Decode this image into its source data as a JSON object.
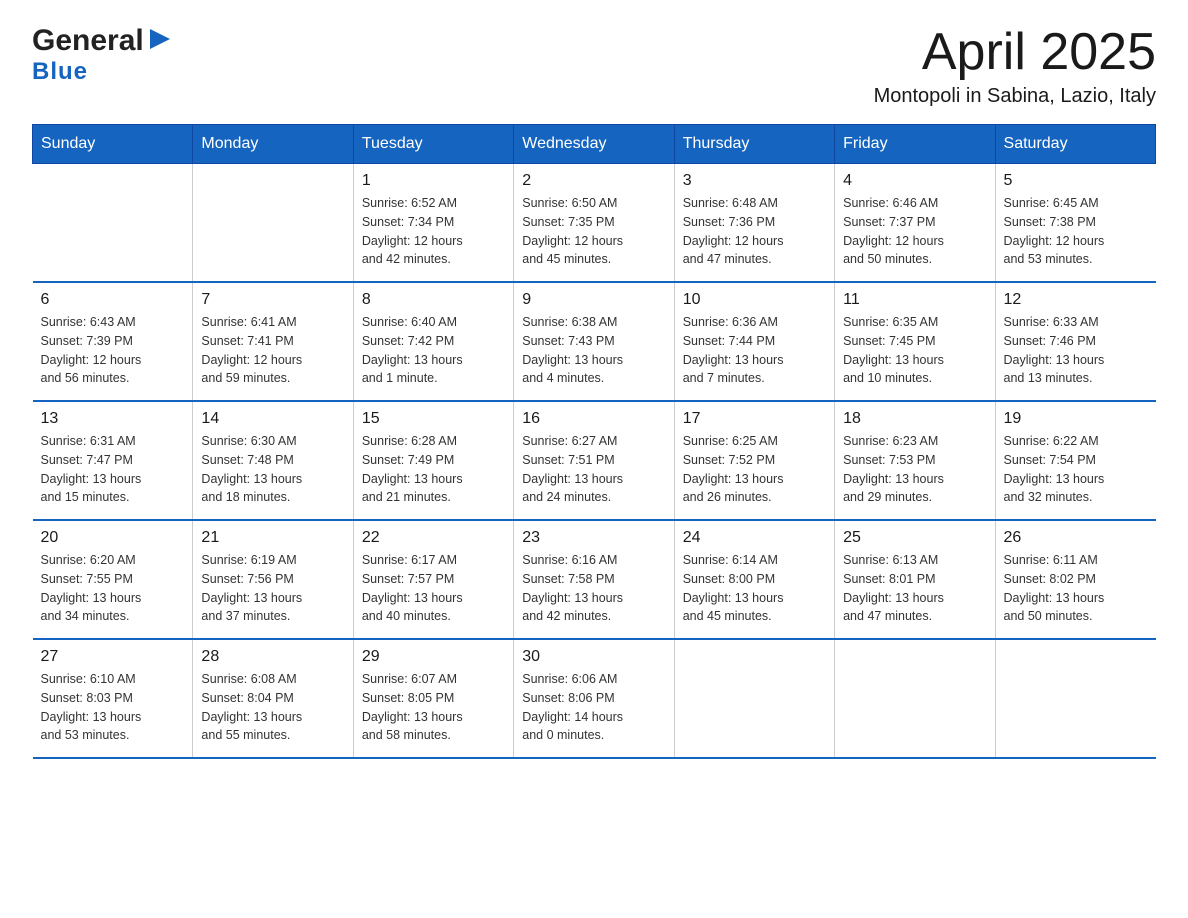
{
  "header": {
    "logo_general": "General",
    "logo_blue": "Blue",
    "title": "April 2025",
    "subtitle": "Montopoli in Sabina, Lazio, Italy"
  },
  "calendar": {
    "days_of_week": [
      "Sunday",
      "Monday",
      "Tuesday",
      "Wednesday",
      "Thursday",
      "Friday",
      "Saturday"
    ],
    "weeks": [
      [
        {
          "day": "",
          "sunrise": "",
          "sunset": "",
          "daylight": ""
        },
        {
          "day": "",
          "sunrise": "",
          "sunset": "",
          "daylight": ""
        },
        {
          "day": "1",
          "sunrise": "Sunrise: 6:52 AM",
          "sunset": "Sunset: 7:34 PM",
          "daylight": "Daylight: 12 hours and 42 minutes."
        },
        {
          "day": "2",
          "sunrise": "Sunrise: 6:50 AM",
          "sunset": "Sunset: 7:35 PM",
          "daylight": "Daylight: 12 hours and 45 minutes."
        },
        {
          "day": "3",
          "sunrise": "Sunrise: 6:48 AM",
          "sunset": "Sunset: 7:36 PM",
          "daylight": "Daylight: 12 hours and 47 minutes."
        },
        {
          "day": "4",
          "sunrise": "Sunrise: 6:46 AM",
          "sunset": "Sunset: 7:37 PM",
          "daylight": "Daylight: 12 hours and 50 minutes."
        },
        {
          "day": "5",
          "sunrise": "Sunrise: 6:45 AM",
          "sunset": "Sunset: 7:38 PM",
          "daylight": "Daylight: 12 hours and 53 minutes."
        }
      ],
      [
        {
          "day": "6",
          "sunrise": "Sunrise: 6:43 AM",
          "sunset": "Sunset: 7:39 PM",
          "daylight": "Daylight: 12 hours and 56 minutes."
        },
        {
          "day": "7",
          "sunrise": "Sunrise: 6:41 AM",
          "sunset": "Sunset: 7:41 PM",
          "daylight": "Daylight: 12 hours and 59 minutes."
        },
        {
          "day": "8",
          "sunrise": "Sunrise: 6:40 AM",
          "sunset": "Sunset: 7:42 PM",
          "daylight": "Daylight: 13 hours and 1 minute."
        },
        {
          "day": "9",
          "sunrise": "Sunrise: 6:38 AM",
          "sunset": "Sunset: 7:43 PM",
          "daylight": "Daylight: 13 hours and 4 minutes."
        },
        {
          "day": "10",
          "sunrise": "Sunrise: 6:36 AM",
          "sunset": "Sunset: 7:44 PM",
          "daylight": "Daylight: 13 hours and 7 minutes."
        },
        {
          "day": "11",
          "sunrise": "Sunrise: 6:35 AM",
          "sunset": "Sunset: 7:45 PM",
          "daylight": "Daylight: 13 hours and 10 minutes."
        },
        {
          "day": "12",
          "sunrise": "Sunrise: 6:33 AM",
          "sunset": "Sunset: 7:46 PM",
          "daylight": "Daylight: 13 hours and 13 minutes."
        }
      ],
      [
        {
          "day": "13",
          "sunrise": "Sunrise: 6:31 AM",
          "sunset": "Sunset: 7:47 PM",
          "daylight": "Daylight: 13 hours and 15 minutes."
        },
        {
          "day": "14",
          "sunrise": "Sunrise: 6:30 AM",
          "sunset": "Sunset: 7:48 PM",
          "daylight": "Daylight: 13 hours and 18 minutes."
        },
        {
          "day": "15",
          "sunrise": "Sunrise: 6:28 AM",
          "sunset": "Sunset: 7:49 PM",
          "daylight": "Daylight: 13 hours and 21 minutes."
        },
        {
          "day": "16",
          "sunrise": "Sunrise: 6:27 AM",
          "sunset": "Sunset: 7:51 PM",
          "daylight": "Daylight: 13 hours and 24 minutes."
        },
        {
          "day": "17",
          "sunrise": "Sunrise: 6:25 AM",
          "sunset": "Sunset: 7:52 PM",
          "daylight": "Daylight: 13 hours and 26 minutes."
        },
        {
          "day": "18",
          "sunrise": "Sunrise: 6:23 AM",
          "sunset": "Sunset: 7:53 PM",
          "daylight": "Daylight: 13 hours and 29 minutes."
        },
        {
          "day": "19",
          "sunrise": "Sunrise: 6:22 AM",
          "sunset": "Sunset: 7:54 PM",
          "daylight": "Daylight: 13 hours and 32 minutes."
        }
      ],
      [
        {
          "day": "20",
          "sunrise": "Sunrise: 6:20 AM",
          "sunset": "Sunset: 7:55 PM",
          "daylight": "Daylight: 13 hours and 34 minutes."
        },
        {
          "day": "21",
          "sunrise": "Sunrise: 6:19 AM",
          "sunset": "Sunset: 7:56 PM",
          "daylight": "Daylight: 13 hours and 37 minutes."
        },
        {
          "day": "22",
          "sunrise": "Sunrise: 6:17 AM",
          "sunset": "Sunset: 7:57 PM",
          "daylight": "Daylight: 13 hours and 40 minutes."
        },
        {
          "day": "23",
          "sunrise": "Sunrise: 6:16 AM",
          "sunset": "Sunset: 7:58 PM",
          "daylight": "Daylight: 13 hours and 42 minutes."
        },
        {
          "day": "24",
          "sunrise": "Sunrise: 6:14 AM",
          "sunset": "Sunset: 8:00 PM",
          "daylight": "Daylight: 13 hours and 45 minutes."
        },
        {
          "day": "25",
          "sunrise": "Sunrise: 6:13 AM",
          "sunset": "Sunset: 8:01 PM",
          "daylight": "Daylight: 13 hours and 47 minutes."
        },
        {
          "day": "26",
          "sunrise": "Sunrise: 6:11 AM",
          "sunset": "Sunset: 8:02 PM",
          "daylight": "Daylight: 13 hours and 50 minutes."
        }
      ],
      [
        {
          "day": "27",
          "sunrise": "Sunrise: 6:10 AM",
          "sunset": "Sunset: 8:03 PM",
          "daylight": "Daylight: 13 hours and 53 minutes."
        },
        {
          "day": "28",
          "sunrise": "Sunrise: 6:08 AM",
          "sunset": "Sunset: 8:04 PM",
          "daylight": "Daylight: 13 hours and 55 minutes."
        },
        {
          "day": "29",
          "sunrise": "Sunrise: 6:07 AM",
          "sunset": "Sunset: 8:05 PM",
          "daylight": "Daylight: 13 hours and 58 minutes."
        },
        {
          "day": "30",
          "sunrise": "Sunrise: 6:06 AM",
          "sunset": "Sunset: 8:06 PM",
          "daylight": "Daylight: 14 hours and 0 minutes."
        },
        {
          "day": "",
          "sunrise": "",
          "sunset": "",
          "daylight": ""
        },
        {
          "day": "",
          "sunrise": "",
          "sunset": "",
          "daylight": ""
        },
        {
          "day": "",
          "sunrise": "",
          "sunset": "",
          "daylight": ""
        }
      ]
    ]
  }
}
